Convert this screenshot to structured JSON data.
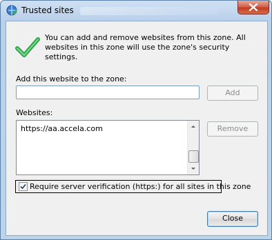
{
  "window": {
    "title": "Trusted sites"
  },
  "info": {
    "message": "You can add and remove websites from this zone. All websites in this zone will use the zone's security settings."
  },
  "add_site": {
    "label": "Add this website to the zone:",
    "value": "",
    "button": "Add"
  },
  "websites": {
    "label": "Websites:",
    "items": [
      "https://aa.accela.com"
    ],
    "remove_button": "Remove"
  },
  "verification": {
    "label": "Require server verification (https:) for all sites in this zone",
    "checked": true
  },
  "footer": {
    "close_button": "Close"
  },
  "colors": {
    "accent_check": "#2ea44f",
    "title_close": "#c13d22"
  }
}
